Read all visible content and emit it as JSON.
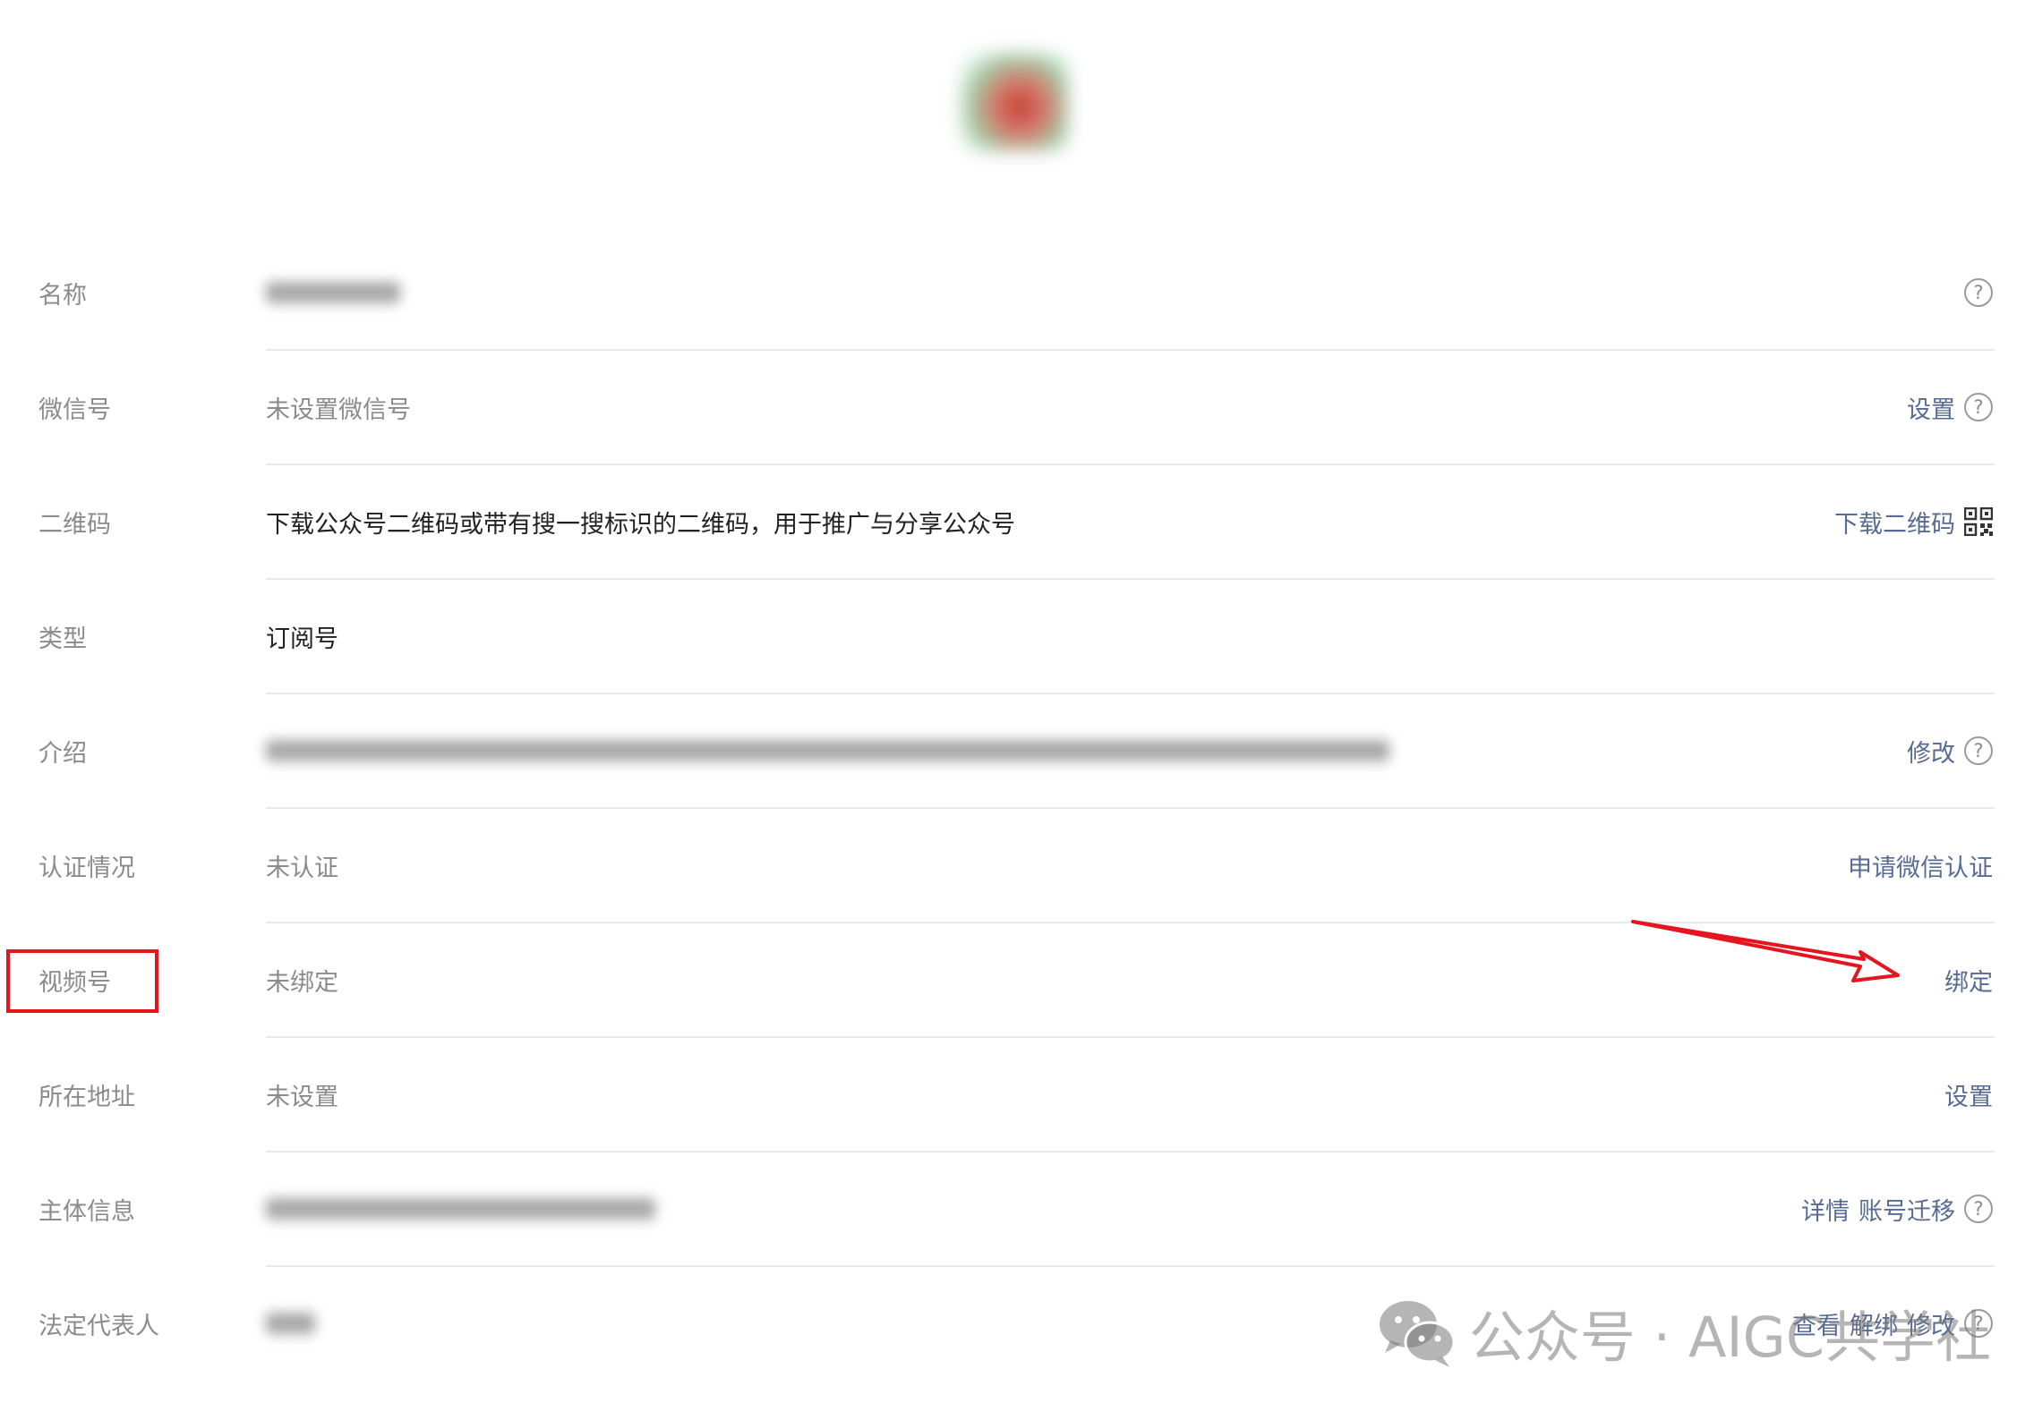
{
  "rows": [
    {
      "label": "名称"
    },
    {
      "label": "微信号",
      "value": "未设置微信号",
      "action": "设置"
    },
    {
      "label": "二维码",
      "value": "下载公众号二维码或带有搜一搜标识的二维码，用于推广与分享公众号",
      "action": "下载二维码"
    },
    {
      "label": "类型",
      "value": "订阅号"
    },
    {
      "label": "介绍",
      "action": "修改"
    },
    {
      "label": "认证情况",
      "value": "未认证",
      "action": "申请微信认证"
    },
    {
      "label": "视频号",
      "value": "未绑定",
      "action": "绑定"
    },
    {
      "label": "所在地址",
      "value": "未设置",
      "action": "设置"
    },
    {
      "label": "主体信息",
      "action1": "详情",
      "action2": "账号迁移"
    },
    {
      "label": "法定代表人",
      "action1": "查看",
      "action2": "解绑",
      "action3": "修改"
    }
  ],
  "help_glyph": "?",
  "watermark": {
    "text": "公众号 · AIGC共学社",
    "icon": "wechat-icon"
  },
  "colors": {
    "link": "#576b95",
    "label": "#8b8b8b",
    "highlight": "#e4151f"
  }
}
